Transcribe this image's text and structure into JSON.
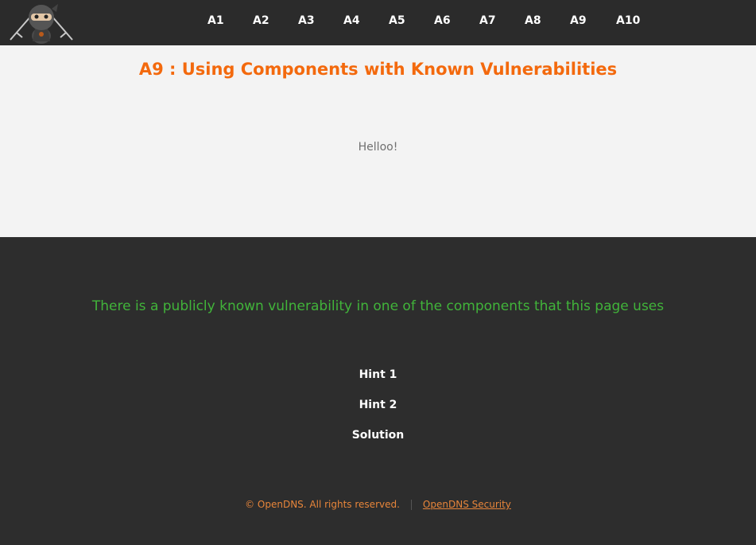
{
  "header": {
    "nav_items": [
      "A1",
      "A2",
      "A3",
      "A4",
      "A5",
      "A6",
      "A7",
      "A8",
      "A9",
      "A10"
    ]
  },
  "main": {
    "title": "A9 : Using Components with Known Vulnerabilities",
    "greeting": "Helloo!"
  },
  "footer": {
    "description": "There is a publicly known vulnerability in one of the components that this page uses",
    "hint1": "Hint 1",
    "hint2": "Hint 2",
    "solution": "Solution",
    "copyright": "© OpenDNS. All rights reserved.",
    "security_link": "OpenDNS Security"
  },
  "colors": {
    "accent": "#f3690d",
    "description_green": "#41b43a",
    "footer_link": "#e7853a"
  }
}
